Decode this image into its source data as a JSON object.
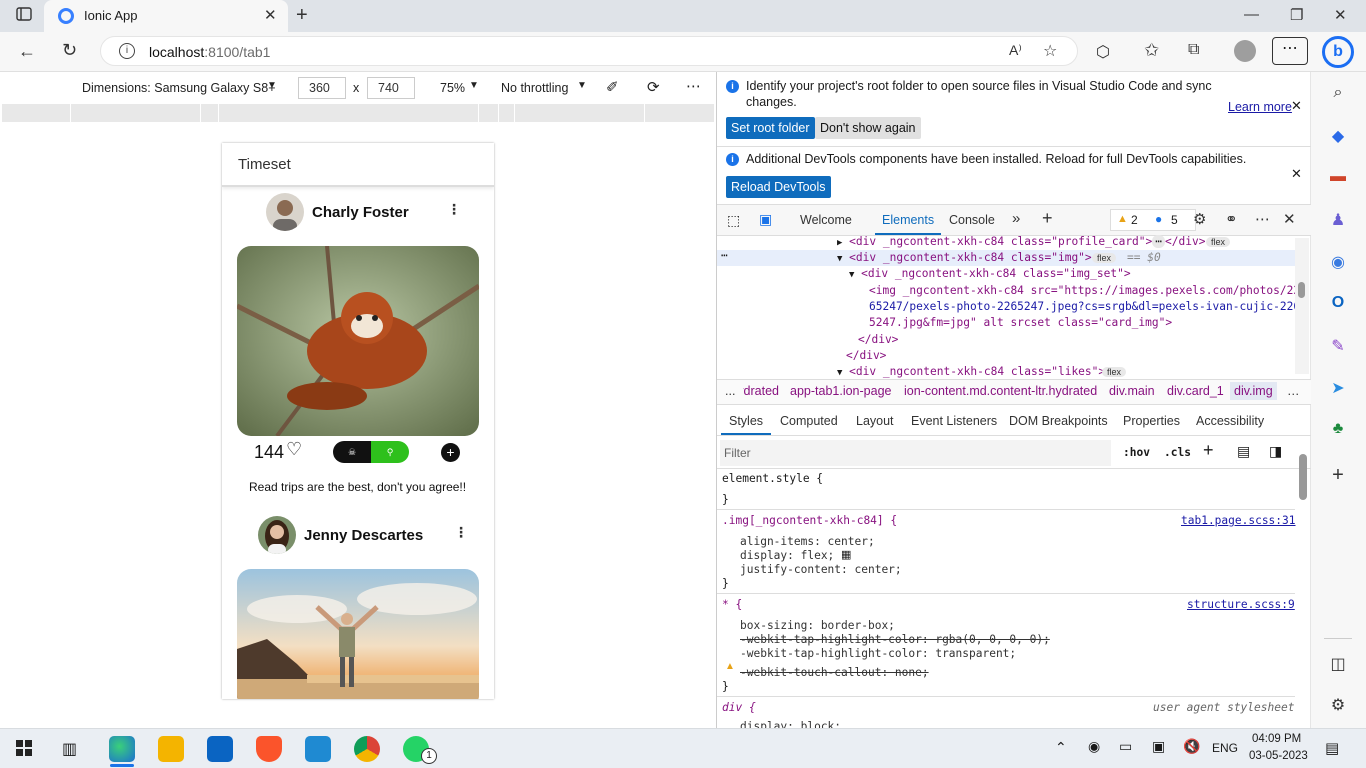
{
  "browser": {
    "tab_title": "Ionic App",
    "url_host": "localhost",
    "url_rest": ":8100/tab1"
  },
  "device_toolbar": {
    "dimensions_label": "Dimensions: Samsung Galaxy S8+",
    "width": "360",
    "height": "740",
    "times": "x",
    "zoom": "75%",
    "throttling": "No throttling"
  },
  "app": {
    "header_title": "Timeset",
    "posts": [
      {
        "name": "Charly Foster",
        "likes": "144",
        "caption": "Read trips are the best, don't you agree!!"
      },
      {
        "name": "Jenny Descartes"
      }
    ]
  },
  "devtools": {
    "banner1": {
      "text": "Identify your project's root folder to open source files in Visual Studio Code and sync changes.",
      "learn_more": "Learn more",
      "set_root": "Set root folder",
      "dont_show": "Don't show again"
    },
    "banner2": {
      "text": "Additional DevTools components have been installed. Reload for full DevTools capabilities.",
      "reload": "Reload DevTools"
    },
    "tabs": [
      "Welcome",
      "Elements",
      "Console"
    ],
    "warnings": "2",
    "messages": "5",
    "dom": {
      "l1": "<div _ngcontent-xkh-c84 class=\"profile_card\">",
      "l1b": "</div>",
      "l2": "<div _ngcontent-xkh-c84 class=\"img\">",
      "l2b": "== $0",
      "l3": "<div _ngcontent-xkh-c84 class=\"img_set\">",
      "l4": "<img _ngcontent-xkh-c84 src=\"https://images.pexels.com/photos/22",
      "l5": "65247/pexels-photo-2265247.jpeg?cs=srgb&dl=pexels-ivan-cujic-226",
      "l6": "5247.jpg&fm=jpg\" alt srcset class=\"card_img\">",
      "l7": "</div>",
      "l8": "</div>",
      "l9": "<div _ngcontent-xkh-c84 class=\"likes\">",
      "flex": "flex"
    },
    "breadcrumbs": [
      "...",
      "hydrated",
      "app-tab1.ion-page",
      "ion-content.md.content-ltr.hydrated",
      "div.main",
      "div.card_1",
      "div.img"
    ],
    "style_tabs": [
      "Styles",
      "Computed",
      "Layout",
      "Event Listeners",
      "DOM Breakpoints",
      "Properties",
      "Accessibility"
    ],
    "filter_placeholder": "Filter",
    "hov": ":hov",
    "cls": ".cls",
    "styles": {
      "element_style": "element.style {",
      "close": "}",
      "rule1_sel": ".img[_ngcontent-xkh-c84] {",
      "rule1_src": "tab1.page.scss:31",
      "rule1_p1": "align-items: center;",
      "rule1_p2": "display: flex;",
      "rule1_p3": "justify-content: center;",
      "rule2_sel": "* {",
      "rule2_src": "structure.scss:9",
      "rule2_p1": "box-sizing: border-box;",
      "rule2_p2": "-webkit-tap-highlight-color: rgba(0, 0, 0, 0);",
      "rule2_p3": "-webkit-tap-highlight-color: transparent;",
      "rule2_p4": "-webkit-touch-callout: none;",
      "rule3_sel": "div {",
      "rule3_src": "user agent stylesheet",
      "rule3_p1": "display: block;"
    }
  },
  "taskbar": {
    "lang": "ENG",
    "time": "04:09 PM",
    "date": "03-05-2023"
  }
}
